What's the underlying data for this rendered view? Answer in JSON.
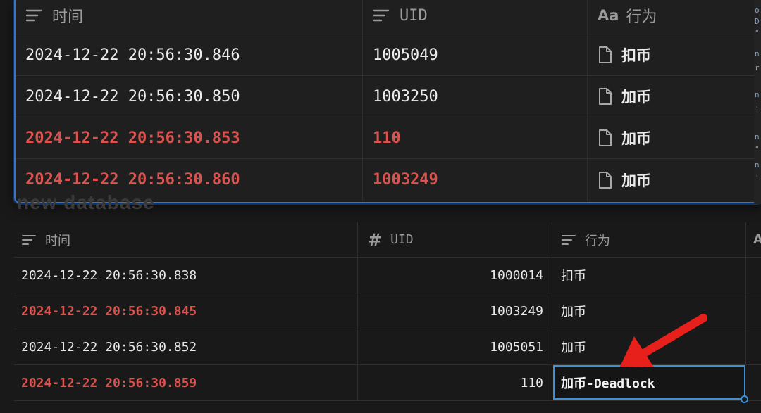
{
  "top_table": {
    "headers": [
      {
        "label": "时间",
        "icon": "text-lines-icon"
      },
      {
        "label": "UID",
        "icon": "text-lines-icon"
      },
      {
        "label": "行为",
        "icon": "title-aa-icon",
        "icon_text": "Aa"
      }
    ],
    "rows": [
      {
        "time": "2024-12-22 20:56:30.846",
        "uid": "1005049",
        "action": "扣币",
        "highlight": false
      },
      {
        "time": "2024-12-22 20:56:30.850",
        "uid": "1003250",
        "action": "加币",
        "highlight": false
      },
      {
        "time": "2024-12-22 20:56:30.853",
        "uid": "110",
        "action": "加币",
        "highlight": true
      },
      {
        "time": "2024-12-22 20:56:30.860",
        "uid": "1003249",
        "action": "加币",
        "highlight": true
      }
    ]
  },
  "ghost_text": "new database",
  "code_peek": [
    "o",
    "D",
    "\"",
    "n",
    "r",
    "n",
    "'",
    "n",
    "\"",
    "n",
    "'"
  ],
  "bottom_table": {
    "headers": [
      {
        "label": "时间",
        "icon": "text-lines-icon"
      },
      {
        "label": "UID",
        "icon": "hash-icon",
        "icon_text": "#"
      },
      {
        "label": "行为",
        "icon": "text-lines-icon"
      },
      {
        "label": "A",
        "icon": ""
      }
    ],
    "rows": [
      {
        "time": "2024-12-22 20:56:30.838",
        "uid": "1000014",
        "action": "扣币",
        "highlight": false
      },
      {
        "time": "2024-12-22 20:56:30.845",
        "uid": "1003249",
        "action": "加币",
        "highlight": true
      },
      {
        "time": "2024-12-22 20:56:30.852",
        "uid": "1005051",
        "action": "加币",
        "highlight": false
      },
      {
        "time": "2024-12-22 20:56:30.859",
        "uid": "110",
        "action": "加币-Deadlock",
        "highlight": true
      }
    ]
  },
  "colors": {
    "highlight_red": "#d9534f",
    "selection_blue": "#3d8fd6",
    "arrow_red": "#e8201c"
  }
}
